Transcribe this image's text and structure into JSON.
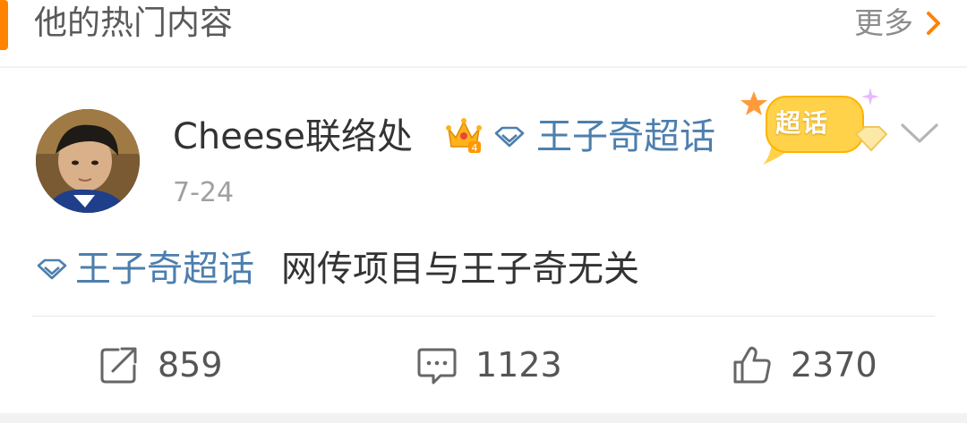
{
  "header": {
    "title": "他的热门内容",
    "more_label": "更多",
    "accent_color": "#ff8200"
  },
  "post": {
    "author": "Cheese联络处",
    "author_badge_icon": "crown-level-icon",
    "topic": "王子奇超话",
    "badge_label": "超话",
    "date": "7-24",
    "body_topic": "王子奇超话",
    "body_text": "网传项目与王子奇无关",
    "link_color": "#4d7fae"
  },
  "actions": {
    "repost_count": "859",
    "comment_count": "1123",
    "like_count": "2370"
  }
}
